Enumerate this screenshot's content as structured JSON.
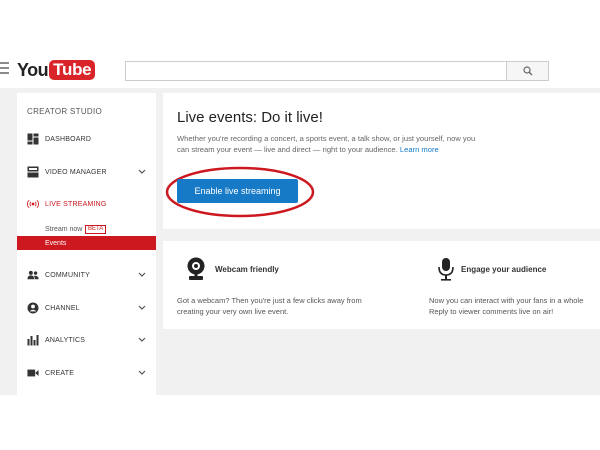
{
  "header": {
    "logo_you": "You",
    "logo_tube": "Tube",
    "search_placeholder": ""
  },
  "sidebar": {
    "title": "CREATOR STUDIO",
    "items": [
      {
        "label": "DASHBOARD",
        "icon": "dashboard-icon"
      },
      {
        "label": "VIDEO MANAGER",
        "icon": "video-manager-icon"
      },
      {
        "label": "LIVE STREAMING",
        "icon": "live-streaming-icon"
      },
      {
        "label": "COMMUNITY",
        "icon": "community-icon"
      },
      {
        "label": "CHANNEL",
        "icon": "channel-icon"
      },
      {
        "label": "ANALYTICS",
        "icon": "analytics-icon"
      },
      {
        "label": "CREATE",
        "icon": "create-icon"
      }
    ],
    "sub_items": {
      "stream_now": "Stream now",
      "beta": "BETA",
      "events": "Events"
    }
  },
  "main": {
    "heading": "Live events: Do it live!",
    "description": "Whether you're recording a concert, a sports event, a talk show, or just yourself, now you can stream your event — live and direct — right to your audience.",
    "learn_more": "Learn more",
    "enable_button": "Enable live streaming"
  },
  "features": [
    {
      "title": "Webcam friendly",
      "icon": "webcam-icon",
      "description_1": "Got a webcam? Then you're just a few clicks away from",
      "description_2": "creating your very own live event."
    },
    {
      "title": "Engage your audience",
      "icon": "microphone-icon",
      "description_1": "Now you can interact with your fans in a whole",
      "description_2": "Reply to viewer comments live on air!"
    }
  ],
  "colors": {
    "brand_red": "#d9252a",
    "active_red": "#cc181e",
    "button_blue": "#167ac6",
    "background_gray": "#f1f1f1"
  }
}
